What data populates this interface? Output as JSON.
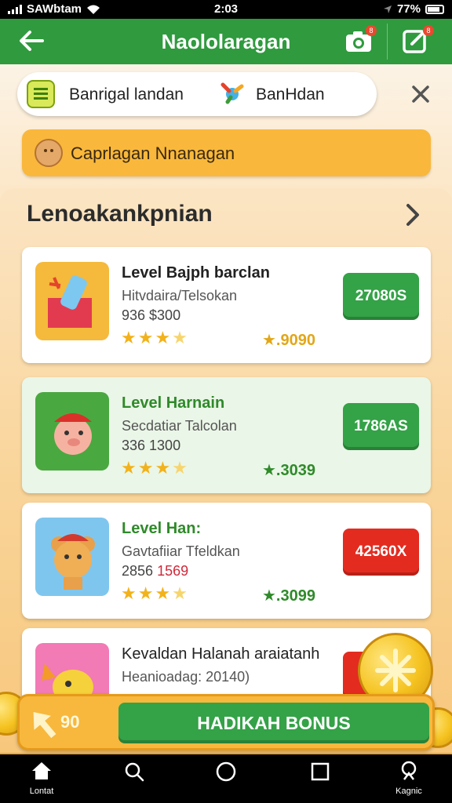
{
  "status_bar": {
    "carrier": "SAWbtam",
    "time": "2:03",
    "battery": "77%"
  },
  "app_bar": {
    "title": "Naololaragan",
    "camera_badge": "8",
    "edit_badge": "8"
  },
  "search_bar": {
    "option_1": "Banrigal landan",
    "option_2": "BanHdan"
  },
  "promo": {
    "label": "Caprlagan Nnanagan"
  },
  "section": {
    "title": "Lenoakankpnian"
  },
  "cards": [
    {
      "title": "Level Bajph barclan",
      "subtitle": "Hitvdaira/Telsokan",
      "price": "936 $300",
      "price_extra": "",
      "rating_stars": 4,
      "score": "★.9090",
      "button": "27080S",
      "button_color": "#34a247",
      "score_color": "#e3a617",
      "theme": "white"
    },
    {
      "title": "Level Harnain",
      "subtitle": "Secdatiar Talcolan",
      "price": "336 1300",
      "price_extra": "",
      "rating_stars": 4,
      "score": "★.3039",
      "button": "1786AS",
      "button_color": "#34a247",
      "score_color": "#2f8a2a",
      "theme": "green"
    },
    {
      "title": "Level Han:",
      "subtitle": "Gavtafiiar Tfeldkan",
      "price": "2856",
      "price_extra": "1569",
      "rating_stars": 4,
      "score": "★.3099",
      "button": "42560X",
      "button_color": "#e42b20",
      "score_color": "#2f8a2a",
      "theme": "white"
    },
    {
      "title": "Kevaldan Halanah araiatanh",
      "subtitle": "Heanioadag: 20140)",
      "price": "",
      "price_extra": "",
      "rating_stars": 0,
      "score": "",
      "button": "",
      "button_color": "#e42b20",
      "score_color": "#2f8a2a",
      "theme": "white"
    }
  ],
  "bonus_bar": {
    "count": "90",
    "cta": "HADIKAH BONUS"
  },
  "nav_bar": {
    "home_label": "Lontat",
    "profile_label": "Kagnic"
  }
}
